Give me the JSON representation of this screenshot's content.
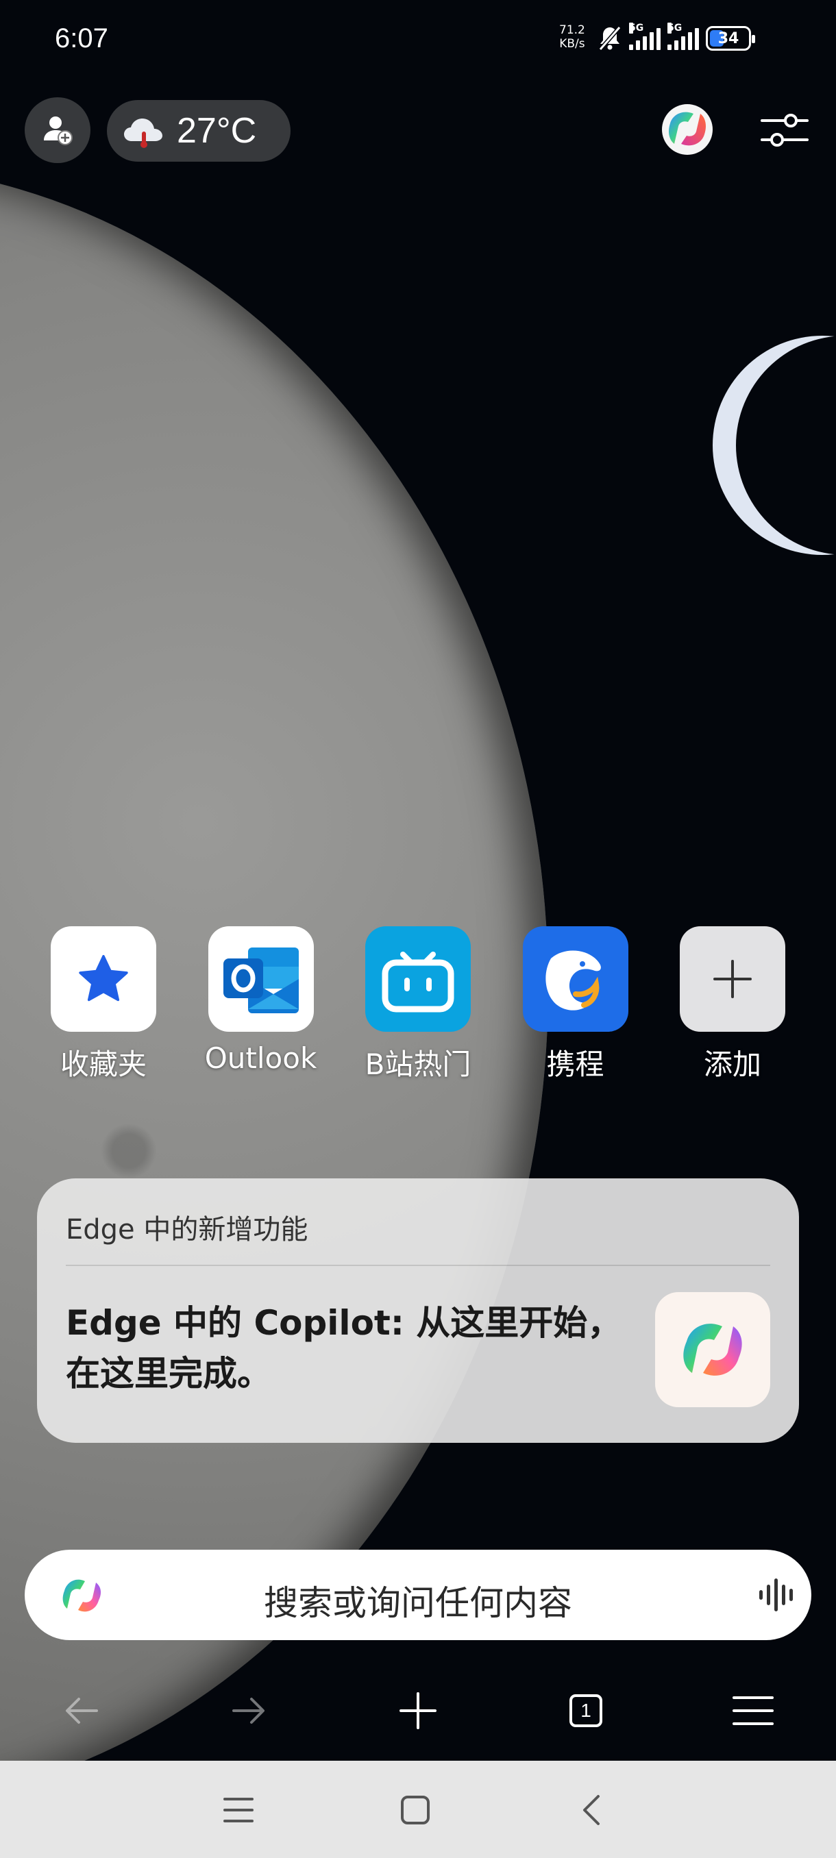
{
  "status_bar": {
    "time": "6:07",
    "net_speed_value": "71.2",
    "net_speed_unit": "KB/s",
    "sim1": "5G",
    "sim2": "5G",
    "battery": "34"
  },
  "top_bar": {
    "weather_temp": "27°C"
  },
  "quick_links": [
    {
      "label": "收藏夹",
      "icon": "star-icon",
      "tile_color": "#ffffff"
    },
    {
      "label": "Outlook",
      "icon": "outlook-icon",
      "tile_color": "#ffffff"
    },
    {
      "label": "B站热门",
      "icon": "bilibili-tv-icon",
      "tile_color": "#0aa3e0"
    },
    {
      "label": "携程",
      "icon": "dolphin-icon",
      "tile_color": "#1e6de8"
    },
    {
      "label": "添加",
      "icon": "plus-icon",
      "tile_color": "#e2e2e4"
    }
  ],
  "news_card": {
    "heading": "Edge 中的新增功能",
    "title": "Edge 中的 Copilot: 从这里开始，在这里完成。"
  },
  "search": {
    "placeholder": "搜索或询问任何内容"
  },
  "toolbar": {
    "tab_count": "1"
  }
}
